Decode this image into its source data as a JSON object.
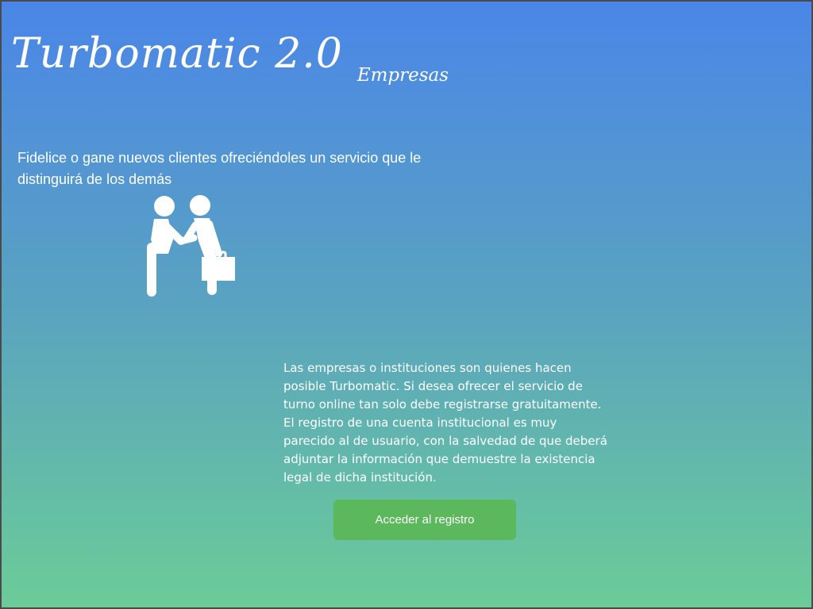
{
  "header": {
    "title": "Turbomatic 2.0",
    "subtitle": "Empresas"
  },
  "hero": {
    "tagline": "Fidelice o gane nuevos clientes ofreciéndoles un servicio que le distinguirá de los demás",
    "icon": "handshake-icon"
  },
  "info": {
    "description": "Las empresas o instituciones son quienes hacen posible Turbomatic. Si desea ofrecer el servicio de turno online tan solo debe registrarse gratuitamente. El registro de una cuenta institucional es muy parecido al de usuario, con la salvedad de que deberá adjuntar la información que demuestre la existencia legal de dicha institución.",
    "button_label": "Acceder al registro"
  },
  "colors": {
    "gradient_top": "#4a86e8",
    "gradient_bottom": "#6bcc98",
    "button": "#5cb85c",
    "text": "#ffffff"
  }
}
